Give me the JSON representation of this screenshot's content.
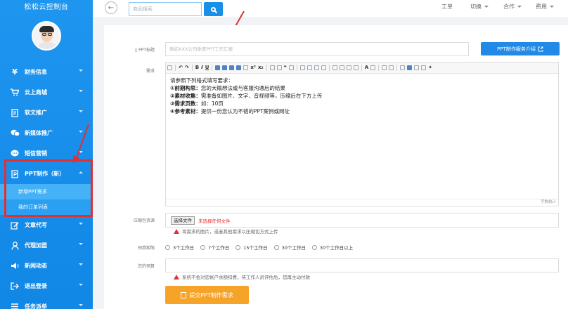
{
  "sidebar": {
    "brand": "松松云控制台",
    "items": [
      {
        "label": "财务信息",
        "icon": "yen-icon"
      },
      {
        "label": "云上商城",
        "icon": "cart-icon"
      },
      {
        "label": "软文推广",
        "icon": "document-icon"
      },
      {
        "label": "新媒体推广",
        "icon": "wechat-icon"
      },
      {
        "label": "短信营销",
        "icon": "chat-bubble-icon"
      },
      {
        "label": "PPT制作（新）",
        "icon": "ppt-icon"
      },
      {
        "label": "文章代写",
        "icon": "pen-icon"
      },
      {
        "label": "代理加盟",
        "icon": "user-icon"
      },
      {
        "label": "新闻动态",
        "icon": "speaker-icon"
      },
      {
        "label": "退出登录",
        "icon": "logout-icon"
      },
      {
        "label": "任务派单",
        "icon": "list-icon"
      }
    ],
    "ppt_submenu": [
      "新增PPT需求",
      "我的订单列表"
    ]
  },
  "topbar": {
    "search_placeholder": "商品搜索",
    "nav": [
      "工单",
      "切换",
      "合作",
      "费用"
    ]
  },
  "form": {
    "title_label": "PPT标题",
    "title_placeholder": "例如XXX公司季度PPT工作汇报",
    "service_button": "PPT制作服务介绍",
    "requirement_label": "需求",
    "editor_lines": [
      {
        "bold": "",
        "text": "请参照下列格式填写要求："
      },
      {
        "bold": "①前期构思：",
        "text": "您的大概想法或与客服沟通后的结果"
      },
      {
        "bold": "②素材收集：",
        "text": "需准备如图片、文字、音视频等，压缩后在下方上传"
      },
      {
        "bold": "③需求页数：",
        "text": "如：10页"
      },
      {
        "bold": "④参考素材：",
        "text": "提供一份您认为不错的PPT案例或网址"
      }
    ],
    "word_count": "字数统计",
    "upload_label": "压缩包资源",
    "choose_file": "选择文件",
    "no_file": "未选择任何文件",
    "upload_tip": "将需求的图片，或者其他需求以压缩包方式上传",
    "deadline_label": "预算期限",
    "deadline_options": [
      "3个工作日",
      "7个工作日",
      "15个工作日",
      "30个工作日",
      "30个工作日以上"
    ],
    "budget_label": "您的预算",
    "budget_tip": "系统不会对您帐户余额扣费，待工作人员评估后，您再主动付款",
    "submit": "提交PPT制作需求"
  },
  "colors": {
    "sidebar": "#1a8fe8",
    "accent": "#2189e6",
    "submit": "#f6a32a",
    "highlight": "#e23030"
  }
}
